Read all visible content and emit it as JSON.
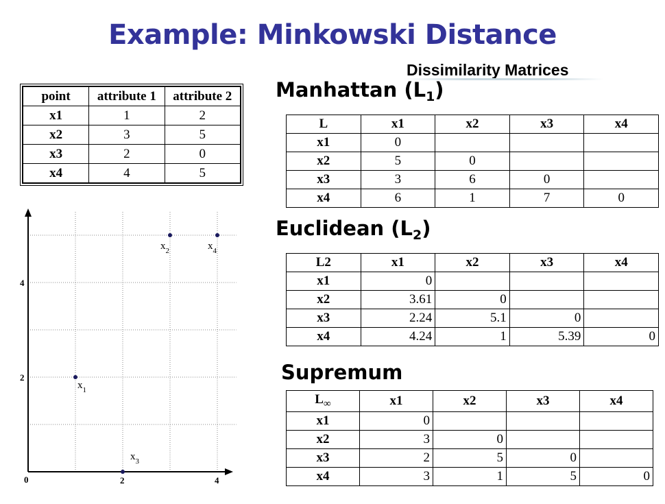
{
  "title": "Example: Minkowski Distance",
  "subtitle": "Dissimilarity Matrices",
  "data_table": {
    "headers": [
      "point",
      "attribute 1",
      "attribute 2"
    ],
    "rows": [
      [
        "x1",
        "1",
        "2"
      ],
      [
        "x2",
        "3",
        "5"
      ],
      [
        "x3",
        "2",
        "0"
      ],
      [
        "x4",
        "4",
        "5"
      ]
    ]
  },
  "manhattan": {
    "heading": "Manhattan (L",
    "heading_sub": "1",
    "heading_end": ")",
    "corner": "L",
    "headers": [
      "x1",
      "x2",
      "x3",
      "x4"
    ],
    "rows": [
      [
        "x1",
        "0",
        "",
        "",
        ""
      ],
      [
        "x2",
        "5",
        "0",
        "",
        ""
      ],
      [
        "x3",
        "3",
        "6",
        "0",
        ""
      ],
      [
        "x4",
        "6",
        "1",
        "7",
        "0"
      ]
    ]
  },
  "euclidean": {
    "heading": "Euclidean (L",
    "heading_sub": "2",
    "heading_end": ")",
    "corner": "L2",
    "headers": [
      "x1",
      "x2",
      "x3",
      "x4"
    ],
    "rows": [
      [
        "x1",
        "0",
        "",
        "",
        ""
      ],
      [
        "x2",
        "3.61",
        "0",
        "",
        ""
      ],
      [
        "x3",
        "2.24",
        "5.1",
        "0",
        ""
      ],
      [
        "x4",
        "4.24",
        "1",
        "5.39",
        "0"
      ]
    ]
  },
  "supremum": {
    "heading": "Supremum",
    "corner": "L",
    "corner_sub": "∞",
    "headers": [
      "x1",
      "x2",
      "x3",
      "x4"
    ],
    "rows": [
      [
        "x1",
        "0",
        "",
        "",
        ""
      ],
      [
        "x2",
        "3",
        "0",
        "",
        ""
      ],
      [
        "x3",
        "2",
        "5",
        "0",
        ""
      ],
      [
        "x4",
        "3",
        "1",
        "5",
        "0"
      ]
    ]
  },
  "plot": {
    "y_ticks": [
      "4",
      "2"
    ],
    "x_ticks": [
      "2",
      "4"
    ],
    "origin_label": "0",
    "points": [
      {
        "label": "x",
        "sub": "1",
        "x": 1,
        "y": 2
      },
      {
        "label": "x",
        "sub": "2",
        "x": 3,
        "y": 5
      },
      {
        "label": "x",
        "sub": "3",
        "x": 2,
        "y": 0
      },
      {
        "label": "x",
        "sub": "4",
        "x": 4,
        "y": 5
      }
    ]
  }
}
